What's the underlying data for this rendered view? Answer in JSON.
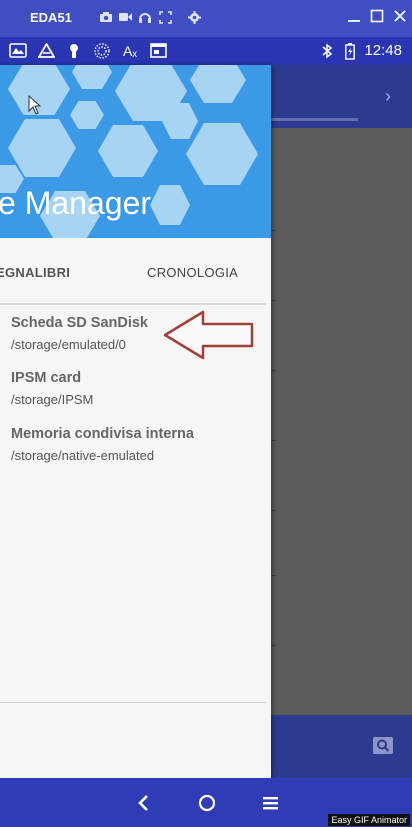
{
  "emulator": {
    "title": "EDA51",
    "icons": [
      "camera-icon",
      "video-icon",
      "headset-icon",
      "fullscreen-icon",
      "settings-icon"
    ],
    "window_controls": [
      "minimize-icon",
      "maximize-icon",
      "close-icon"
    ]
  },
  "statusbar": {
    "icons": [
      "gallery-icon",
      "drive-icon",
      "keyhole-icon",
      "dotted-globe-icon",
      "translate-icon",
      "browser-icon"
    ],
    "time": "12:48"
  },
  "drawer": {
    "title": "e Manager",
    "tabs": [
      {
        "label": "EGNALIBRI"
      },
      {
        "label": "CRONOLOGIA"
      }
    ],
    "items": [
      {
        "title": "Scheda SD SanDisk",
        "path": "/storage/emulated/0"
      },
      {
        "title": "IPSM card",
        "path": "/storage/IPSM"
      },
      {
        "title": "Memoria condivisa interna",
        "path": "/storage/native-emulated"
      }
    ]
  },
  "colors": {
    "header": "#3c99e6",
    "statusbar": "#2a36b1",
    "titlebar": "#3f4ec1",
    "arrow": "#a04038"
  },
  "watermark": "Easy GIF Animator"
}
